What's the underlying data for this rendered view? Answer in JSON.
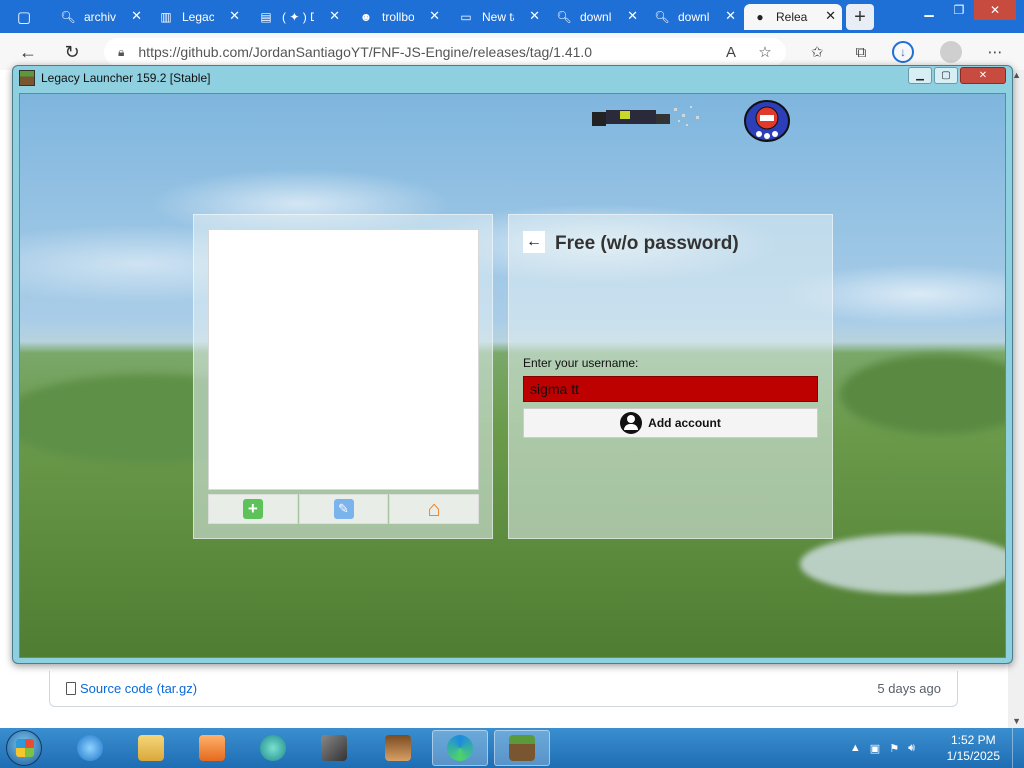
{
  "browser": {
    "tabs": [
      {
        "title": "archive",
        "icon": "search-icon"
      },
      {
        "title": "Legacy",
        "icon": "library-icon"
      },
      {
        "title": "( ✦ ) D",
        "icon": "image-icon"
      },
      {
        "title": "trollbo",
        "icon": "troll-icon"
      },
      {
        "title": "New ta",
        "icon": "newtab-icon"
      },
      {
        "title": "downl",
        "icon": "search-icon"
      },
      {
        "title": "downl",
        "icon": "search-icon"
      },
      {
        "title": "Releas",
        "icon": "github-icon"
      }
    ],
    "url": "https://github.com/JordanSantiagoYT/FNF-JS-Engine/releases/tag/1.41.0",
    "accent": "#1e6fd6"
  },
  "github": {
    "asset_name": "Source code",
    "asset_ext": "(tar.gz)",
    "asset_date": "5 days ago"
  },
  "launcher": {
    "title": "Legacy Launcher 159.2 [Stable]",
    "panel_title": "Free (w/o password)",
    "username_label": "Enter your username:",
    "username_value": "sigma tt",
    "add_account_label": "Add account",
    "input_color": "#bd0000"
  },
  "taskbar": {
    "time": "1:52 PM",
    "date": "1/15/2025"
  }
}
